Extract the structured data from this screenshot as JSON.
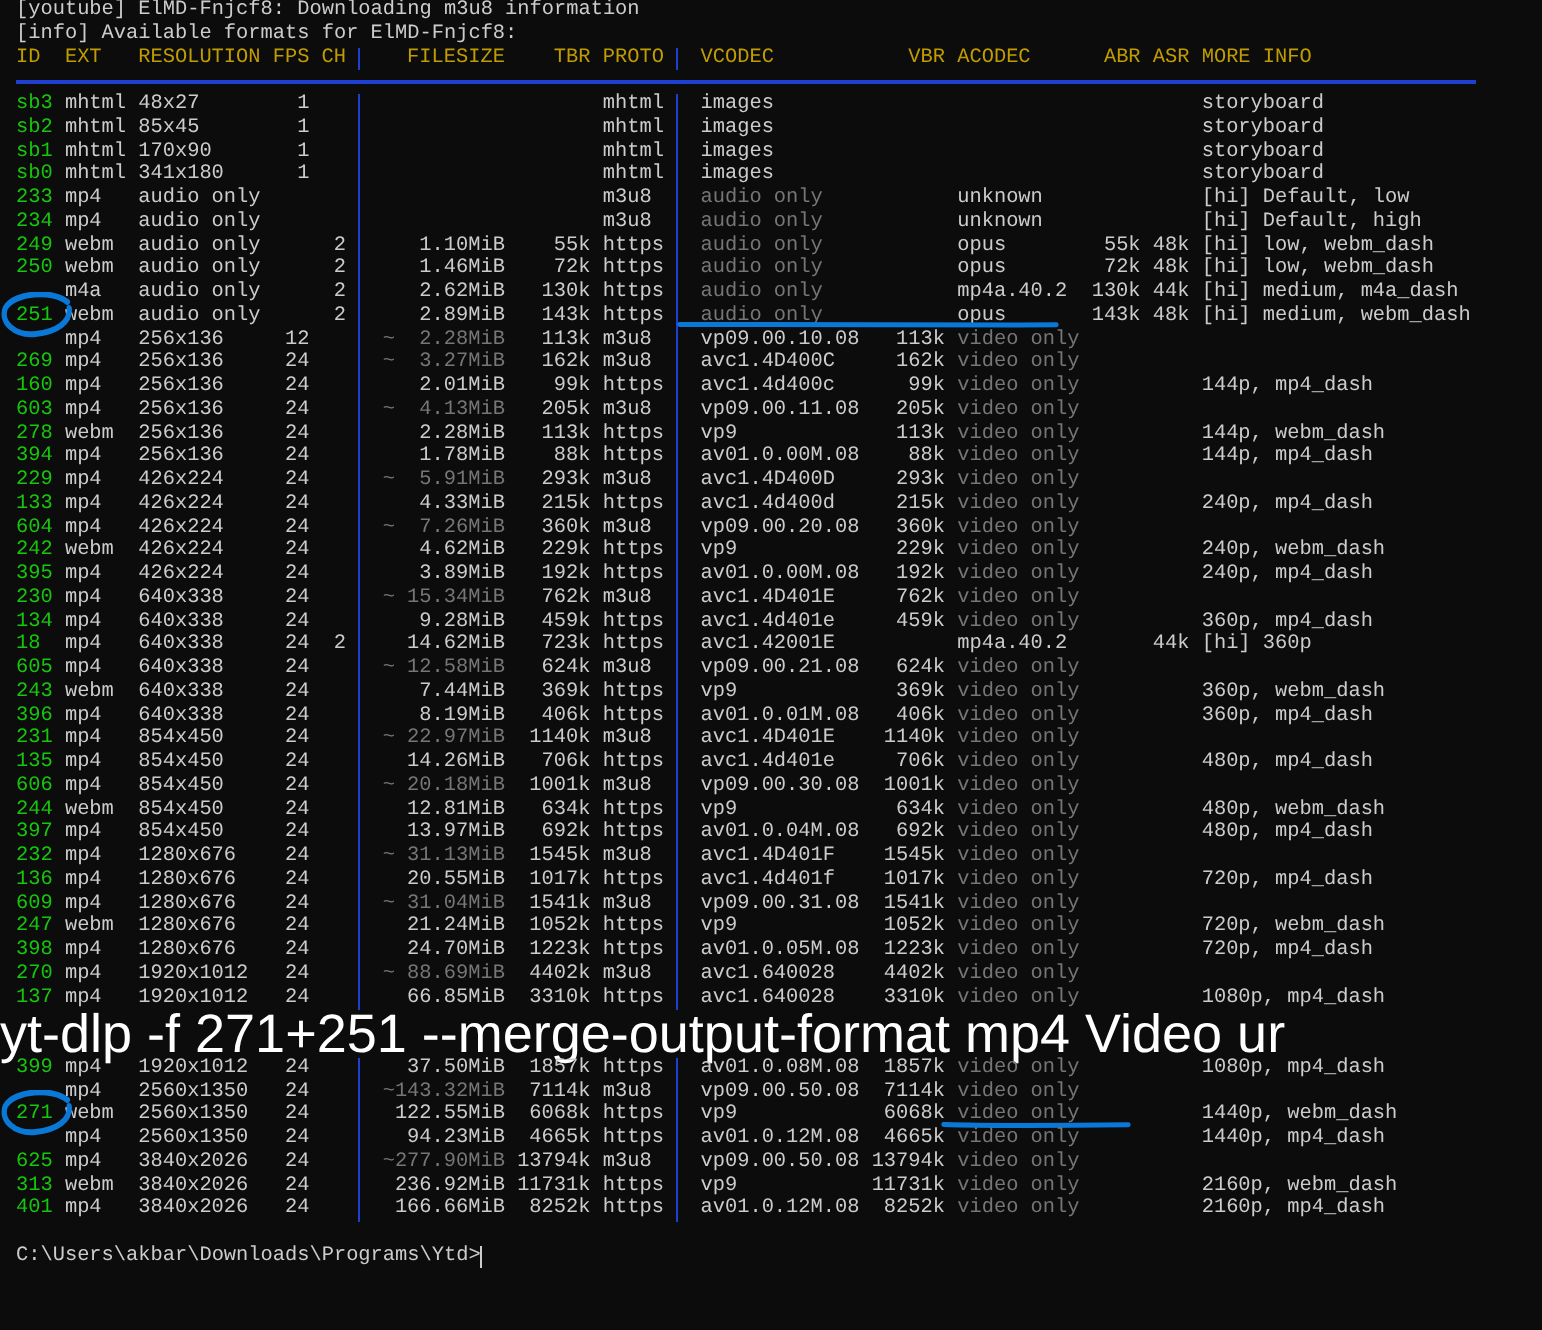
{
  "log_lines": [
    "[youtube] ElMD-Fnjcf8: Downloading m3u8 information",
    "[info] Available formats for ElMD-Fnjcf8:"
  ],
  "columns": [
    "ID",
    "EXT",
    "RESOLUTION",
    "FPS",
    "CH",
    "FILESIZE",
    "TBR",
    "PROTO",
    "VCODEC",
    "VBR",
    "ACODEC",
    "ABR",
    "ASR",
    "MORE INFO"
  ],
  "rows_top": [
    {
      "kind": "storyboard",
      "id": "sb3",
      "ext": "mhtml",
      "resolution": "48x27",
      "fps": "1",
      "proto": "mhtml",
      "vcodec": "images",
      "more_info": "storyboard"
    },
    {
      "kind": "storyboard",
      "id": "sb2",
      "ext": "mhtml",
      "resolution": "85x45",
      "fps": "1",
      "proto": "mhtml",
      "vcodec": "images",
      "more_info": "storyboard"
    },
    {
      "kind": "storyboard",
      "id": "sb1",
      "ext": "mhtml",
      "resolution": "170x90",
      "fps": "1",
      "proto": "mhtml",
      "vcodec": "images",
      "more_info": "storyboard"
    },
    {
      "kind": "storyboard",
      "id": "sb0",
      "ext": "mhtml",
      "resolution": "341x180",
      "fps": "1",
      "proto": "mhtml",
      "vcodec": "images",
      "more_info": "storyboard"
    },
    {
      "kind": "audio",
      "id": "233",
      "ext": "mp4",
      "resolution": "audio only",
      "proto": "m3u8",
      "vcodec": "audio only",
      "acodec": "unknown",
      "more_info": "[hi] Default, low"
    },
    {
      "kind": "audio",
      "id": "234",
      "ext": "mp4",
      "resolution": "audio only",
      "proto": "m3u8",
      "vcodec": "audio only",
      "acodec": "unknown",
      "more_info": "[hi] Default, high"
    },
    {
      "kind": "audio",
      "id": "249",
      "ext": "webm",
      "resolution": "audio only",
      "ch": "2",
      "filesize": "1.10MiB",
      "tbr": "55k",
      "proto": "https",
      "vcodec": "audio only",
      "acodec": "opus",
      "abr": "55k",
      "asr": "48k",
      "more_info": "[hi] low, webm_dash"
    },
    {
      "kind": "audio",
      "id": "250",
      "ext": "webm",
      "resolution": "audio only",
      "ch": "2",
      "filesize": "1.46MiB",
      "tbr": "72k",
      "proto": "https",
      "vcodec": "audio only",
      "acodec": "opus",
      "abr": "72k",
      "asr": "48k",
      "more_info": "[hi] low, webm_dash"
    },
    {
      "kind": "audio",
      "ext": "m4a",
      "resolution": "audio only",
      "ch": "2",
      "filesize": "2.62MiB",
      "tbr": "130k",
      "proto": "https",
      "vcodec": "audio only",
      "acodec": "mp4a.40.2",
      "abr": "130k",
      "asr": "44k",
      "more_info": "[hi] medium, m4a_dash"
    },
    {
      "kind": "audio",
      "circled": true,
      "underlined": true,
      "id": "251",
      "ext": "webm",
      "resolution": "audio only",
      "ch": "2",
      "filesize": "2.89MiB",
      "tbr": "143k",
      "proto": "https",
      "vcodec": "audio only",
      "acodec": "opus",
      "abr": "143k",
      "asr": "48k",
      "more_info": "[hi] medium, webm_dash"
    },
    {
      "kind": "video",
      "ext": "mp4",
      "resolution": "256x136",
      "fps": "12",
      "approx": "~",
      "filesize": "2.28MiB",
      "tbr": "113k",
      "proto": "m3u8",
      "vcodec": "vp09.00.10.08",
      "vbr": "113k",
      "acodec": "video only"
    },
    {
      "kind": "video",
      "id": "269",
      "ext": "mp4",
      "resolution": "256x136",
      "fps": "24",
      "approx": "~",
      "filesize": "3.27MiB",
      "tbr": "162k",
      "proto": "m3u8",
      "vcodec": "avc1.4D400C",
      "vbr": "162k",
      "acodec": "video only"
    },
    {
      "kind": "video",
      "id": "160",
      "ext": "mp4",
      "resolution": "256x136",
      "fps": "24",
      "filesize": "2.01MiB",
      "tbr": "99k",
      "proto": "https",
      "vcodec": "avc1.4d400c",
      "vbr": "99k",
      "acodec": "video only",
      "more_info": "144p, mp4_dash"
    },
    {
      "kind": "video",
      "id": "603",
      "ext": "mp4",
      "resolution": "256x136",
      "fps": "24",
      "approx": "~",
      "filesize": "4.13MiB",
      "tbr": "205k",
      "proto": "m3u8",
      "vcodec": "vp09.00.11.08",
      "vbr": "205k",
      "acodec": "video only"
    },
    {
      "kind": "video",
      "id": "278",
      "ext": "webm",
      "resolution": "256x136",
      "fps": "24",
      "filesize": "2.28MiB",
      "tbr": "113k",
      "proto": "https",
      "vcodec": "vp9",
      "vbr": "113k",
      "acodec": "video only",
      "more_info": "144p, webm_dash"
    },
    {
      "kind": "video",
      "id": "394",
      "ext": "mp4",
      "resolution": "256x136",
      "fps": "24",
      "filesize": "1.78MiB",
      "tbr": "88k",
      "proto": "https",
      "vcodec": "av01.0.00M.08",
      "vbr": "88k",
      "acodec": "video only",
      "more_info": "144p, mp4_dash"
    },
    {
      "kind": "video",
      "id": "229",
      "ext": "mp4",
      "resolution": "426x224",
      "fps": "24",
      "approx": "~",
      "filesize": "5.91MiB",
      "tbr": "293k",
      "proto": "m3u8",
      "vcodec": "avc1.4D400D",
      "vbr": "293k",
      "acodec": "video only"
    },
    {
      "kind": "video",
      "id": "133",
      "ext": "mp4",
      "resolution": "426x224",
      "fps": "24",
      "filesize": "4.33MiB",
      "tbr": "215k",
      "proto": "https",
      "vcodec": "avc1.4d400d",
      "vbr": "215k",
      "acodec": "video only",
      "more_info": "240p, mp4_dash"
    },
    {
      "kind": "video",
      "id": "604",
      "ext": "mp4",
      "resolution": "426x224",
      "fps": "24",
      "approx": "~",
      "filesize": "7.26MiB",
      "tbr": "360k",
      "proto": "m3u8",
      "vcodec": "vp09.00.20.08",
      "vbr": "360k",
      "acodec": "video only"
    },
    {
      "kind": "video",
      "id": "242",
      "ext": "webm",
      "resolution": "426x224",
      "fps": "24",
      "filesize": "4.62MiB",
      "tbr": "229k",
      "proto": "https",
      "vcodec": "vp9",
      "vbr": "229k",
      "acodec": "video only",
      "more_info": "240p, webm_dash"
    },
    {
      "kind": "video",
      "id": "395",
      "ext": "mp4",
      "resolution": "426x224",
      "fps": "24",
      "filesize": "3.89MiB",
      "tbr": "192k",
      "proto": "https",
      "vcodec": "av01.0.00M.08",
      "vbr": "192k",
      "acodec": "video only",
      "more_info": "240p, mp4_dash"
    },
    {
      "kind": "video",
      "id": "230",
      "ext": "mp4",
      "resolution": "640x338",
      "fps": "24",
      "approx": "~",
      "filesize": "15.34MiB",
      "tbr": "762k",
      "proto": "m3u8",
      "vcodec": "avc1.4D401E",
      "vbr": "762k",
      "acodec": "video only"
    },
    {
      "kind": "video",
      "id": "134",
      "ext": "mp4",
      "resolution": "640x338",
      "fps": "24",
      "filesize": "9.28MiB",
      "tbr": "459k",
      "proto": "https",
      "vcodec": "avc1.4d401e",
      "vbr": "459k",
      "acodec": "video only",
      "more_info": "360p, mp4_dash"
    },
    {
      "kind": "muxed",
      "id": "18",
      "ext": "mp4",
      "resolution": "640x338",
      "fps": "24",
      "ch": "2",
      "filesize": "14.62MiB",
      "tbr": "723k",
      "proto": "https",
      "vcodec": "avc1.42001E",
      "acodec": "mp4a.40.2",
      "asr": "44k",
      "more_info": "[hi] 360p"
    },
    {
      "kind": "video",
      "id": "605",
      "ext": "mp4",
      "resolution": "640x338",
      "fps": "24",
      "approx": "~",
      "filesize": "12.58MiB",
      "tbr": "624k",
      "proto": "m3u8",
      "vcodec": "vp09.00.21.08",
      "vbr": "624k",
      "acodec": "video only"
    },
    {
      "kind": "video",
      "id": "243",
      "ext": "webm",
      "resolution": "640x338",
      "fps": "24",
      "filesize": "7.44MiB",
      "tbr": "369k",
      "proto": "https",
      "vcodec": "vp9",
      "vbr": "369k",
      "acodec": "video only",
      "more_info": "360p, webm_dash"
    },
    {
      "kind": "video",
      "id": "396",
      "ext": "mp4",
      "resolution": "640x338",
      "fps": "24",
      "filesize": "8.19MiB",
      "tbr": "406k",
      "proto": "https",
      "vcodec": "av01.0.01M.08",
      "vbr": "406k",
      "acodec": "video only",
      "more_info": "360p, mp4_dash"
    },
    {
      "kind": "video",
      "id": "231",
      "ext": "mp4",
      "resolution": "854x450",
      "fps": "24",
      "approx": "~",
      "filesize": "22.97MiB",
      "tbr": "1140k",
      "proto": "m3u8",
      "vcodec": "avc1.4D401E",
      "vbr": "1140k",
      "acodec": "video only"
    },
    {
      "kind": "video",
      "id": "135",
      "ext": "mp4",
      "resolution": "854x450",
      "fps": "24",
      "filesize": "14.26MiB",
      "tbr": "706k",
      "proto": "https",
      "vcodec": "avc1.4d401e",
      "vbr": "706k",
      "acodec": "video only",
      "more_info": "480p, mp4_dash"
    },
    {
      "kind": "video",
      "id": "606",
      "ext": "mp4",
      "resolution": "854x450",
      "fps": "24",
      "approx": "~",
      "filesize": "20.18MiB",
      "tbr": "1001k",
      "proto": "m3u8",
      "vcodec": "vp09.00.30.08",
      "vbr": "1001k",
      "acodec": "video only"
    },
    {
      "kind": "video",
      "id": "244",
      "ext": "webm",
      "resolution": "854x450",
      "fps": "24",
      "filesize": "12.81MiB",
      "tbr": "634k",
      "proto": "https",
      "vcodec": "vp9",
      "vbr": "634k",
      "acodec": "video only",
      "more_info": "480p, webm_dash"
    },
    {
      "kind": "video",
      "id": "397",
      "ext": "mp4",
      "resolution": "854x450",
      "fps": "24",
      "filesize": "13.97MiB",
      "tbr": "692k",
      "proto": "https",
      "vcodec": "av01.0.04M.08",
      "vbr": "692k",
      "acodec": "video only",
      "more_info": "480p, mp4_dash"
    },
    {
      "kind": "video",
      "id": "232",
      "ext": "mp4",
      "resolution": "1280x676",
      "fps": "24",
      "approx": "~",
      "filesize": "31.13MiB",
      "tbr": "1545k",
      "proto": "m3u8",
      "vcodec": "avc1.4D401F",
      "vbr": "1545k",
      "acodec": "video only"
    },
    {
      "kind": "video",
      "id": "136",
      "ext": "mp4",
      "resolution": "1280x676",
      "fps": "24",
      "filesize": "20.55MiB",
      "tbr": "1017k",
      "proto": "https",
      "vcodec": "avc1.4d401f",
      "vbr": "1017k",
      "acodec": "video only",
      "more_info": "720p, mp4_dash"
    },
    {
      "kind": "video",
      "id": "609",
      "ext": "mp4",
      "resolution": "1280x676",
      "fps": "24",
      "approx": "~",
      "filesize": "31.04MiB",
      "tbr": "1541k",
      "proto": "m3u8",
      "vcodec": "vp09.00.31.08",
      "vbr": "1541k",
      "acodec": "video only"
    },
    {
      "kind": "video",
      "id": "247",
      "ext": "webm",
      "resolution": "1280x676",
      "fps": "24",
      "filesize": "21.24MiB",
      "tbr": "1052k",
      "proto": "https",
      "vcodec": "vp9",
      "vbr": "1052k",
      "acodec": "video only",
      "more_info": "720p, webm_dash"
    },
    {
      "kind": "video",
      "id": "398",
      "ext": "mp4",
      "resolution": "1280x676",
      "fps": "24",
      "filesize": "24.70MiB",
      "tbr": "1223k",
      "proto": "https",
      "vcodec": "av01.0.05M.08",
      "vbr": "1223k",
      "acodec": "video only",
      "more_info": "720p, mp4_dash"
    },
    {
      "kind": "video",
      "id": "270",
      "ext": "mp4",
      "resolution": "1920x1012",
      "fps": "24",
      "approx": "~",
      "filesize": "88.69MiB",
      "tbr": "4402k",
      "proto": "m3u8",
      "vcodec": "avc1.640028",
      "vbr": "4402k",
      "acodec": "video only"
    },
    {
      "kind": "video",
      "id": "137",
      "ext": "mp4",
      "resolution": "1920x1012",
      "fps": "24",
      "filesize": "66.85MiB",
      "tbr": "3310k",
      "proto": "https",
      "vcodec": "avc1.640028",
      "vbr": "3310k",
      "acodec": "video only",
      "more_info": "1080p, mp4_dash"
    }
  ],
  "overlay_caption": "yt-dlp -f 271+251 --merge-output-format mp4 Video ur",
  "rows_bottom": [
    {
      "kind": "video",
      "id": "399",
      "ext": "mp4",
      "resolution": "1920x1012",
      "fps": "24",
      "filesize": "37.50MiB",
      "tbr": "1857k",
      "proto": "https",
      "vcodec": "av01.0.08M.08",
      "vbr": "1857k",
      "acodec": "video only",
      "more_info": "1080p, mp4_dash"
    },
    {
      "kind": "video",
      "ext": "mp4",
      "resolution": "2560x1350",
      "fps": "24",
      "approx": "~",
      "filesize": "143.32MiB",
      "tbr": "7114k",
      "proto": "m3u8",
      "vcodec": "vp09.00.50.08",
      "vbr": "7114k",
      "acodec": "video only"
    },
    {
      "kind": "video",
      "circled": true,
      "underlined": true,
      "id": "271",
      "ext": "webm",
      "resolution": "2560x1350",
      "fps": "24",
      "filesize": "122.55MiB",
      "tbr": "6068k",
      "proto": "https",
      "vcodec": "vp9",
      "vbr": "6068k",
      "acodec": "video only",
      "more_info": "1440p, webm_dash"
    },
    {
      "kind": "video",
      "ext": "mp4",
      "resolution": "2560x1350",
      "fps": "24",
      "filesize": "94.23MiB",
      "tbr": "4665k",
      "proto": "https",
      "vcodec": "av01.0.12M.08",
      "vbr": "4665k",
      "acodec": "video only",
      "more_info": "1440p, mp4_dash"
    },
    {
      "kind": "video",
      "id": "625",
      "ext": "mp4",
      "resolution": "3840x2026",
      "fps": "24",
      "approx": "~",
      "filesize": "277.90MiB",
      "tbr": "13794k",
      "proto": "m3u8",
      "vcodec": "vp09.00.50.08",
      "vbr": "13794k",
      "acodec": "video only"
    },
    {
      "kind": "video",
      "id": "313",
      "ext": "webm",
      "resolution": "3840x2026",
      "fps": "24",
      "filesize": "236.92MiB",
      "tbr": "11731k",
      "proto": "https",
      "vcodec": "vp9",
      "vbr": "11731k",
      "acodec": "video only",
      "more_info": "2160p, webm_dash"
    },
    {
      "kind": "video",
      "id": "401",
      "ext": "mp4",
      "resolution": "3840x2026",
      "fps": "24",
      "filesize": "166.66MiB",
      "tbr": "8252k",
      "proto": "https",
      "vcodec": "av01.0.12M.08",
      "vbr": "8252k",
      "acodec": "video only",
      "more_info": "2160p, mp4_dash"
    }
  ],
  "prompt": "C:\\Users\\akbar\\Downloads\\Programs\\Ytd>"
}
